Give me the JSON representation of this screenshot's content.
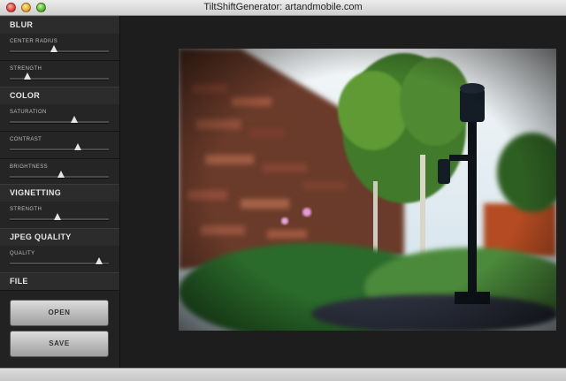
{
  "window": {
    "title": "TiltShiftGenerator: artandmobile.com"
  },
  "sidebar": {
    "blur": {
      "header": "BLUR",
      "center_radius": {
        "label": "CENTER RADIUS",
        "value": 0.45
      },
      "strength": {
        "label": "STRENGTH",
        "value": 0.18
      }
    },
    "color": {
      "header": "COLOR",
      "saturation": {
        "label": "SATURATION",
        "value": 0.65
      },
      "contrast": {
        "label": "CONTRAST",
        "value": 0.69
      },
      "brightness": {
        "label": "BRIGHTNESS",
        "value": 0.52
      }
    },
    "vignetting": {
      "header": "VIGNETTING",
      "strength": {
        "label": "STRENGTH",
        "value": 0.48
      }
    },
    "jpeg_quality": {
      "header": "JPEG QUALITY",
      "quality": {
        "label": "QUALITY",
        "value": 0.9
      }
    },
    "file": {
      "header": "FILE",
      "open_label": "OPEN",
      "save_label": "SAVE"
    }
  },
  "colors": {
    "sidebar_bg": "#222222",
    "section_bg": "#2c2c2c",
    "canvas_bg": "#1d1d1d",
    "button_top": "#dcdcdc",
    "button_bottom": "#9e9e9e"
  }
}
